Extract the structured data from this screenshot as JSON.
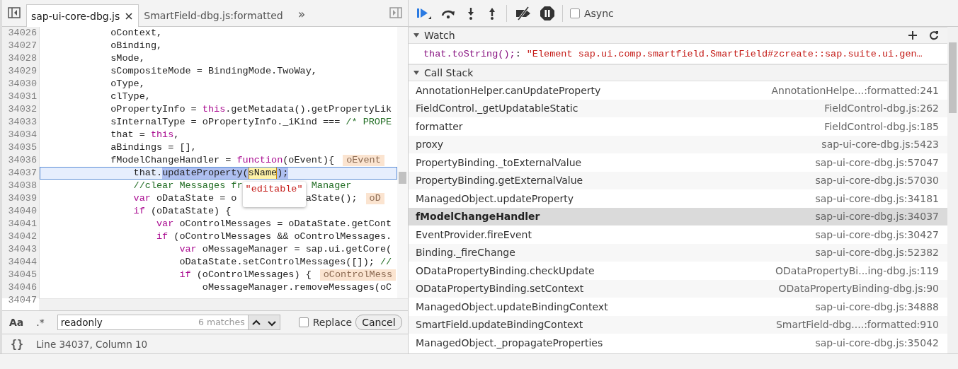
{
  "editor": {
    "tabs": [
      {
        "label": "sap-ui-core-dbg.js",
        "selected": true,
        "closable": true
      },
      {
        "label": "SmartField-dbg.js:formatted",
        "selected": false,
        "closable": false
      }
    ],
    "more_tabs": "»",
    "lines": [
      {
        "number": "34026",
        "current": false,
        "tokens": [
          {
            "kind": "plain",
            "text": "            oContext,"
          }
        ]
      },
      {
        "number": "34027",
        "current": false,
        "tokens": [
          {
            "kind": "plain",
            "text": "            oBinding,"
          }
        ]
      },
      {
        "number": "34028",
        "current": false,
        "tokens": [
          {
            "kind": "plain",
            "text": "            sMode,"
          }
        ]
      },
      {
        "number": "34029",
        "current": false,
        "tokens": [
          {
            "kind": "plain",
            "text": "            sCompositeMode = BindingMode.TwoWay,"
          }
        ]
      },
      {
        "number": "34030",
        "current": false,
        "tokens": [
          {
            "kind": "plain",
            "text": "            oType,"
          }
        ]
      },
      {
        "number": "34031",
        "current": false,
        "tokens": [
          {
            "kind": "plain",
            "text": "            clType,"
          }
        ]
      },
      {
        "number": "34032",
        "current": false,
        "tokens": [
          {
            "kind": "plain",
            "text": "            oPropertyInfo = "
          },
          {
            "kind": "keyword",
            "text": "this"
          },
          {
            "kind": "plain",
            "text": ".getMetadata().getPropertyLik"
          }
        ]
      },
      {
        "number": "34033",
        "current": false,
        "tokens": [
          {
            "kind": "plain",
            "text": "            sInternalType = oPropertyInfo._iKind === "
          },
          {
            "kind": "comment",
            "text": "/* PROPE"
          }
        ]
      },
      {
        "number": "34034",
        "current": false,
        "tokens": [
          {
            "kind": "plain",
            "text": "            that = "
          },
          {
            "kind": "keyword",
            "text": "this"
          },
          {
            "kind": "plain",
            "text": ","
          }
        ]
      },
      {
        "number": "34035",
        "current": false,
        "tokens": [
          {
            "kind": "plain",
            "text": "            aBindings = [],"
          }
        ]
      },
      {
        "number": "34036",
        "current": false,
        "tokens": [
          {
            "kind": "plain",
            "text": "            fModelChangeHandler = "
          },
          {
            "kind": "keyword",
            "text": "function"
          },
          {
            "kind": "plain",
            "text": "(oEvent){"
          },
          {
            "kind": "value",
            "text": "oEvent"
          }
        ]
      },
      {
        "number": "34037",
        "current": true,
        "tokens": [
          {
            "kind": "plain",
            "text": "                that."
          },
          {
            "kind": "selection",
            "text": "updateProperty("
          },
          {
            "kind": "match",
            "text": "sName"
          },
          {
            "kind": "selection",
            "text": ");"
          }
        ]
      },
      {
        "number": "34038",
        "current": false,
        "tokens": [
          {
            "kind": "comment",
            "text": "                //clear Messages fr"
          },
          {
            "kind": "covered"
          },
          {
            "kind": "comment",
            "text": "Manager"
          }
        ]
      },
      {
        "number": "34039",
        "current": false,
        "tokens": [
          {
            "kind": "keyword",
            "text": "                var"
          },
          {
            "kind": "plain",
            "text": " oDataState = o"
          },
          {
            "kind": "covered"
          },
          {
            "kind": "plain",
            "text": "aState();"
          },
          {
            "kind": "value",
            "text": "oD"
          }
        ]
      },
      {
        "number": "34040",
        "current": false,
        "tokens": [
          {
            "kind": "keyword",
            "text": "                if"
          },
          {
            "kind": "plain",
            "text": " (oDataState) {"
          }
        ]
      },
      {
        "number": "34041",
        "current": false,
        "tokens": [
          {
            "kind": "keyword",
            "text": "                    var"
          },
          {
            "kind": "plain",
            "text": " oControlMessages = oDataState.getCont"
          }
        ]
      },
      {
        "number": "34042",
        "current": false,
        "tokens": [
          {
            "kind": "keyword",
            "text": "                    if"
          },
          {
            "kind": "plain",
            "text": " (oControlMessages && oControlMessages."
          }
        ]
      },
      {
        "number": "34043",
        "current": false,
        "tokens": [
          {
            "kind": "keyword",
            "text": "                        var"
          },
          {
            "kind": "plain",
            "text": " oMessageManager = sap.ui.getCore("
          }
        ]
      },
      {
        "number": "34044",
        "current": false,
        "tokens": [
          {
            "kind": "plain",
            "text": "                        oDataState.setControlMessages([]); "
          },
          {
            "kind": "comment",
            "text": "//"
          }
        ]
      },
      {
        "number": "34045",
        "current": false,
        "tokens": [
          {
            "kind": "keyword",
            "text": "                        if"
          },
          {
            "kind": "plain",
            "text": " (oControlMessages) {"
          },
          {
            "kind": "value",
            "text": "oControlMess"
          }
        ]
      },
      {
        "number": "34046",
        "current": false,
        "tokens": [
          {
            "kind": "plain",
            "text": "                            oMessageManager.removeMessages(oC"
          }
        ]
      },
      {
        "number": "34047",
        "current": false
      }
    ],
    "tooltip": "\"editable\"",
    "search": {
      "case_label": "Aa",
      "regex_label": ".*",
      "query": "readonly",
      "match_count": "6 matches",
      "replace": {
        "label": "Replace",
        "checked": false
      },
      "cancel": "Cancel"
    },
    "status": {
      "pretty_print": "{}",
      "text": "Line 34037, Column 10"
    }
  },
  "debugger": {
    "async": {
      "label": "Async",
      "checked": false
    },
    "watch": {
      "title": "Watch",
      "expanded": true,
      "entries": [
        {
          "name": "that.toString();",
          "separator": ":",
          "value": "\"Element sap.ui.comp.smartfield.SmartField#zcreate::sap.suite.ui.gen…"
        }
      ]
    },
    "call_stack": {
      "title": "Call Stack",
      "expanded": true,
      "frames": [
        {
          "function": "AnnotationHelper.canUpdateProperty",
          "location": "AnnotationHelpe...:formatted:241",
          "selected": false
        },
        {
          "function": "FieldControl._getUpdatableStatic",
          "location": "FieldControl-dbg.js:262",
          "selected": false
        },
        {
          "function": "formatter",
          "location": "FieldControl-dbg.js:185",
          "selected": false
        },
        {
          "function": "proxy",
          "location": "sap-ui-core-dbg.js:5423",
          "selected": false
        },
        {
          "function": "PropertyBinding._toExternalValue",
          "location": "sap-ui-core-dbg.js:57047",
          "selected": false
        },
        {
          "function": "PropertyBinding.getExternalValue",
          "location": "sap-ui-core-dbg.js:57030",
          "selected": false
        },
        {
          "function": "ManagedObject.updateProperty",
          "location": "sap-ui-core-dbg.js:34181",
          "selected": false
        },
        {
          "function": "fModelChangeHandler",
          "location": "sap-ui-core-dbg.js:34037",
          "selected": true
        },
        {
          "function": "EventProvider.fireEvent",
          "location": "sap-ui-core-dbg.js:30427",
          "selected": false
        },
        {
          "function": "Binding._fireChange",
          "location": "sap-ui-core-dbg.js:52382",
          "selected": false
        },
        {
          "function": "ODataPropertyBinding.checkUpdate",
          "location": "ODataPropertyBi...ing-dbg.js:119",
          "selected": false
        },
        {
          "function": "ODataPropertyBinding.setContext",
          "location": "ODataPropertyBinding-dbg.js:90",
          "selected": false
        },
        {
          "function": "ManagedObject.updateBindingContext",
          "location": "sap-ui-core-dbg.js:34888",
          "selected": false
        },
        {
          "function": "SmartField.updateBindingContext",
          "location": "SmartField-dbg....:formatted:910",
          "selected": false
        },
        {
          "function": "ManagedObject._propagateProperties",
          "location": "sap-ui-core-dbg.js:35042",
          "selected": false
        }
      ]
    }
  }
}
